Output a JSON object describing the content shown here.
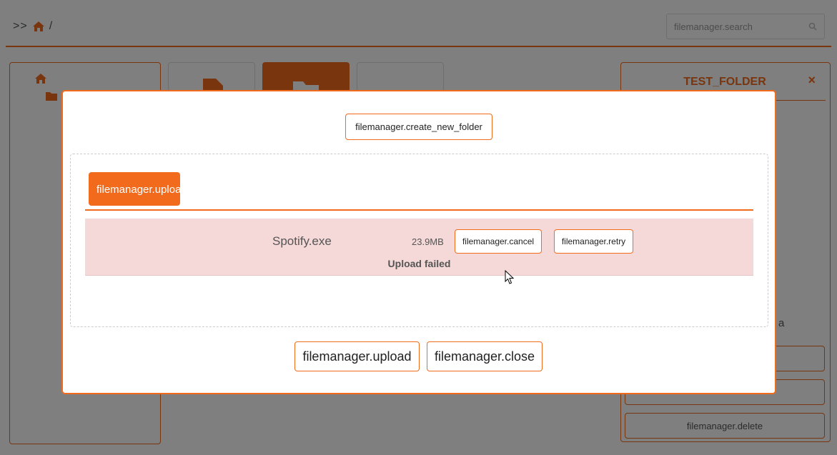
{
  "breadcrumb": {
    "prefix": ">>",
    "separator": "/"
  },
  "search": {
    "placeholder": "filemanager.search"
  },
  "info_panel": {
    "title": "TEST_FOLDER",
    "close_glyph": "×",
    "partial_label": "a",
    "buttons": [
      {
        "label": ""
      },
      {
        "label": ""
      },
      {
        "label": "filemanager.delete"
      }
    ]
  },
  "modal": {
    "create_folder_label": "filemanager.create_new_folder",
    "upload_tab_label": "filemanager.upload",
    "file": {
      "name": "Spotify.exe",
      "size": "23.9MB",
      "cancel_label": "filemanager.cancel",
      "retry_label": "filemanager.retry",
      "status": "Upload failed"
    },
    "footer": {
      "upload_label": "filemanager.upload",
      "close_label": "filemanager.close"
    }
  },
  "colors": {
    "accent": "#f26b1d",
    "error_row": "#f5d8d8",
    "overlay": "rgba(0,0,0,0.5)"
  },
  "icons": [
    "home-icon",
    "search-icon",
    "folder-icon",
    "file-icon",
    "close-icon",
    "mouse-cursor"
  ]
}
